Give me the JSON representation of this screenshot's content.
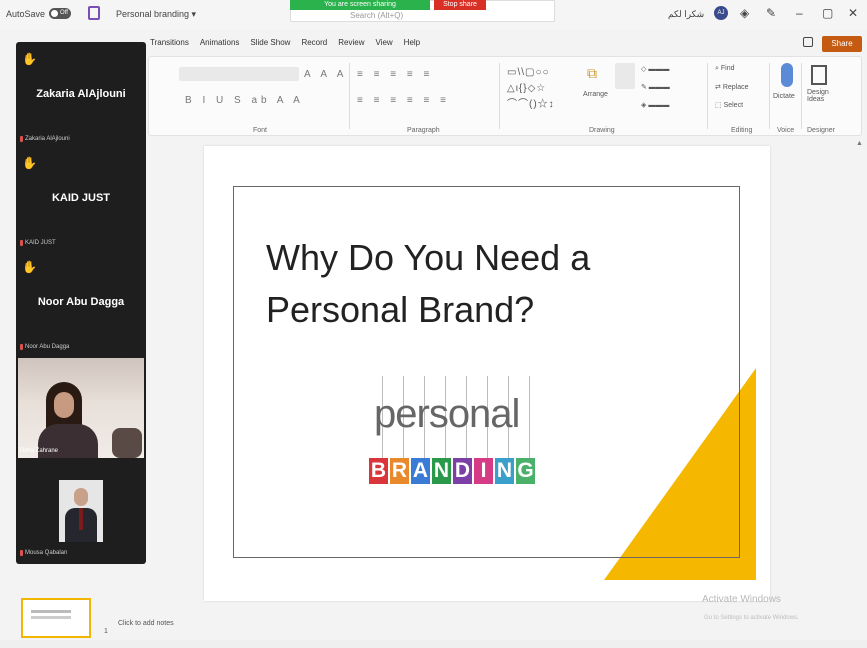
{
  "titlebar": {
    "autosave_label": "AutoSave",
    "autosave_state": "Off",
    "doc_title": "Personal branding ▾",
    "sharing_label": "You are screen sharing",
    "stop_label": "Stop share",
    "search_placeholder": "Search (Alt+Q)",
    "user_name": "شكرا لكم",
    "user_initials": "AJ"
  },
  "ribbon_tabs": [
    "Transitions",
    "Animations",
    "Slide Show",
    "Record",
    "Review",
    "View",
    "Help"
  ],
  "share_label": "Share",
  "ribbon_groups": {
    "font": "Font",
    "paragraph": "Paragraph",
    "drawing": "Drawing",
    "editing": "Editing",
    "voice": "Voice",
    "designer": "Designer",
    "find": "Find",
    "replace": "Replace",
    "select": "Select",
    "arrange": "Arrange",
    "dictate": "Dictate",
    "design_ideas": "Design Ideas"
  },
  "participants": [
    {
      "name": "Zakaria AlAjlouni",
      "label": "Zakaria AlAjlouni"
    },
    {
      "name": "KAID JUST",
      "label": "KAID JUST"
    },
    {
      "name": "Noor Abu Dagga",
      "label": "Noor Abu Dagga"
    },
    {
      "name": "",
      "label": "Dima Zahrane"
    },
    {
      "name": "",
      "label": "Mousa Qabalan"
    }
  ],
  "slide": {
    "title": "Why Do You Need a Personal Brand?",
    "logo_word": "personal",
    "logo_letters": [
      "B",
      "R",
      "A",
      "N",
      "D",
      "I",
      "N",
      "G"
    ],
    "logo_colors": [
      "#d9353b",
      "#e88a2b",
      "#3a7bd5",
      "#2a9a4a",
      "#7b3fa5",
      "#d63b86",
      "#3aa0c9",
      "#4bb06a"
    ]
  },
  "notes_placeholder": "Click to add notes",
  "thumb_number": "1",
  "watermark": {
    "line1": "Activate Windows",
    "line2": "Go to Settings to activate Windows."
  }
}
